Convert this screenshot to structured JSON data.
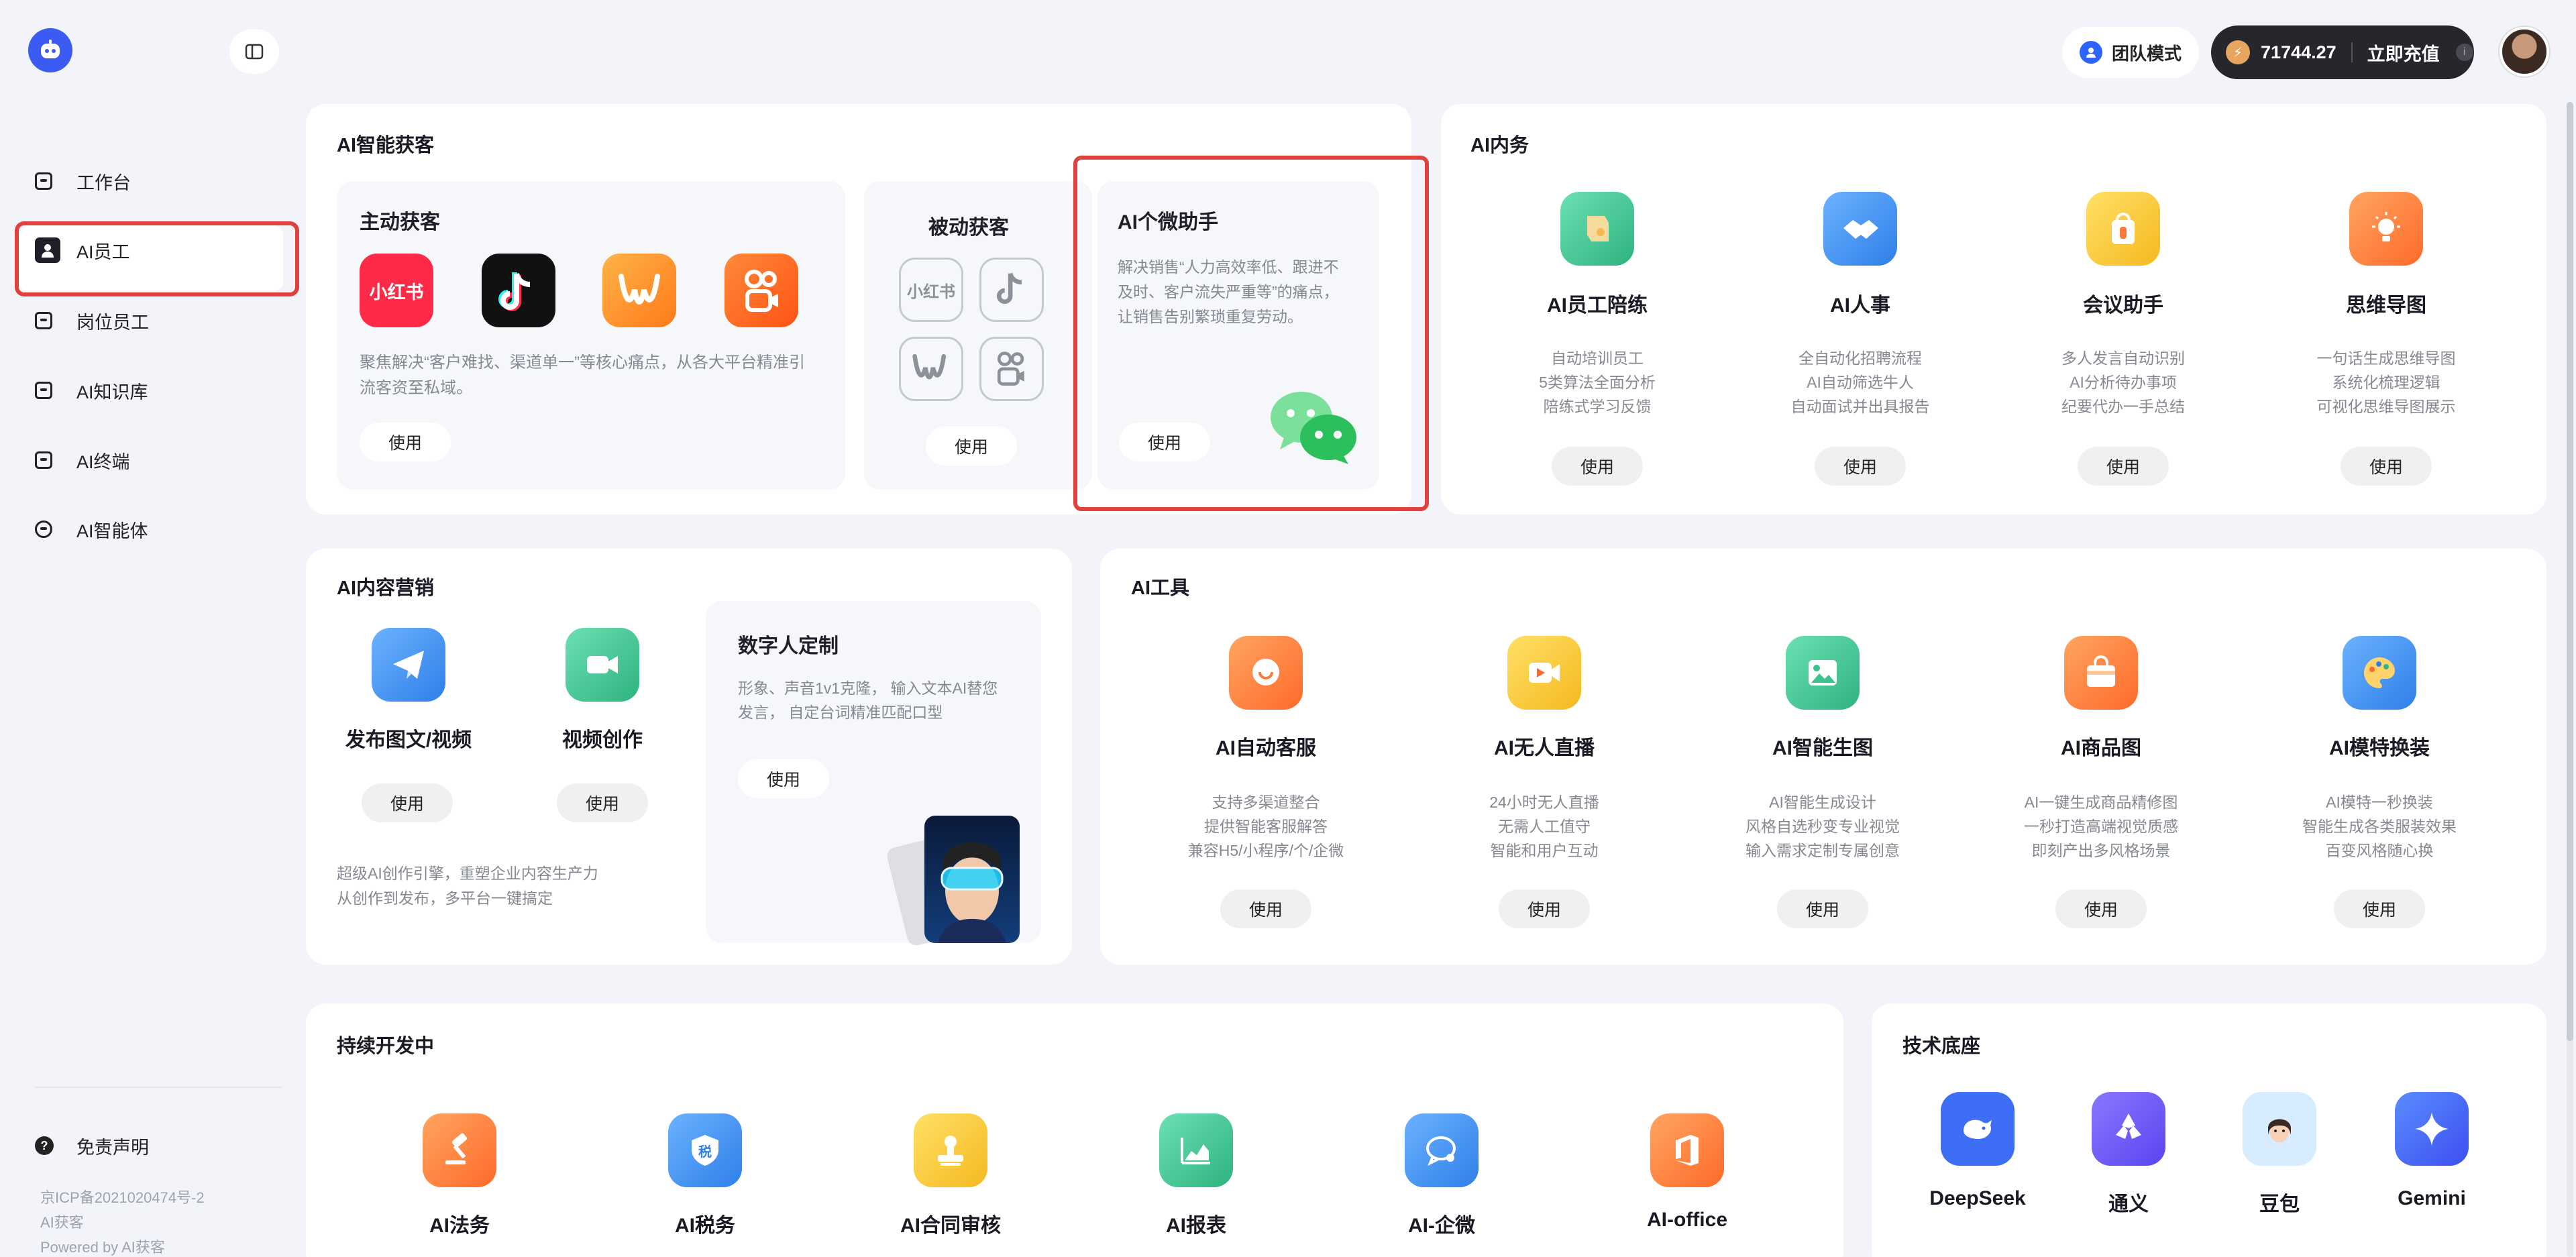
{
  "header": {
    "team_mode_label": "团队模式",
    "balance": "71744.27",
    "recharge_label": "立即充值",
    "info_glyph": "i"
  },
  "sidebar": {
    "items": [
      {
        "label": "工作台",
        "icon": "workbench-icon"
      },
      {
        "label": "AI员工",
        "icon": "ai-staff-icon"
      },
      {
        "label": "岗位员工",
        "icon": "post-staff-icon"
      },
      {
        "label": "AI知识库",
        "icon": "knowledge-icon"
      },
      {
        "label": "AI终端",
        "icon": "terminal-icon"
      },
      {
        "label": "AI智能体",
        "icon": "agent-icon"
      }
    ],
    "disclaimer": "免责声明",
    "icp": "京ICP备2021020474号-2",
    "brand": "AI获客",
    "powered": "Powered by AI获客"
  },
  "acquire": {
    "title": "AI智能获客",
    "active": {
      "title": "主动获客",
      "desc_lines": [
        "聚焦解决“客户难找、渠道单一”等核心痛点，从各大平台精准引",
        "流客资至私域。"
      ],
      "use": "使用",
      "platforms": [
        "小红书",
        "抖音",
        "快手",
        "快手"
      ]
    },
    "passive": {
      "title": "被动获客",
      "use": "使用",
      "xhs_label": "小红书"
    },
    "wechat": {
      "title": "AI个微助手",
      "desc_lines": [
        "解决销售“人力高效率低、跟进不",
        "及时、客户流失严重等”的痛点，",
        "让销售告别繁琐重复劳动。"
      ],
      "use": "使用"
    }
  },
  "internal": {
    "title": "AI内务",
    "items": [
      {
        "name": "AI员工陪练",
        "desc": [
          "自动培训员工",
          "5类算法全面分析",
          "陪练式学习反馈"
        ],
        "use": "使用"
      },
      {
        "name": "AI人事",
        "desc": [
          "全自动化招聘流程",
          "AI自动筛选牛人",
          "自动面试并出具报告"
        ],
        "use": "使用"
      },
      {
        "name": "会议助手",
        "desc": [
          "多人发言自动识别",
          "AI分析待办事项",
          "纪要代办一手总结"
        ],
        "use": "使用"
      },
      {
        "name": "思维导图",
        "desc": [
          "一句话生成思维导图",
          "系统化梳理逻辑",
          "可视化思维导图展示"
        ],
        "use": "使用"
      }
    ]
  },
  "content": {
    "title": "AI内容营销",
    "items": [
      {
        "name": "发布图文/视频",
        "use": "使用"
      },
      {
        "name": "视频创作",
        "use": "使用"
      }
    ],
    "footer_lines": [
      "超级AI创作引擎，重塑企业内容生产力",
      "从创作到发布，多平台一键搞定"
    ],
    "digital": {
      "title": "数字人定制",
      "desc_lines": [
        "形象、声音1v1克隆， 输入文本AI替您",
        "发言， 自定台词精准匹配口型"
      ],
      "use": "使用"
    }
  },
  "tools": {
    "title": "AI工具",
    "items": [
      {
        "name": "AI自动客服",
        "desc": [
          "支持多渠道整合",
          "提供智能客服解答",
          "兼容H5/小程序/个/企微"
        ],
        "use": "使用"
      },
      {
        "name": "AI无人直播",
        "desc": [
          "24小时无人直播",
          "无需人工值守",
          "智能和用户互动"
        ],
        "use": "使用"
      },
      {
        "name": "AI智能生图",
        "desc": [
          "AI智能生成设计",
          "风格自选秒变专业视觉",
          "输入需求定制专属创意"
        ],
        "use": "使用"
      },
      {
        "name": "AI商品图",
        "desc": [
          "AI一键生成商品精修图",
          "一秒打造高端视觉质感",
          "即刻产出多风格场景"
        ],
        "use": "使用"
      },
      {
        "name": "AI模特换装",
        "desc": [
          "AI模特一秒换装",
          "智能生成各类服装效果",
          "百变风格随心换"
        ],
        "use": "使用"
      }
    ]
  },
  "dev": {
    "title": "持续开发中",
    "items": [
      {
        "name": "AI法务"
      },
      {
        "name": "AI税务",
        "badge": "税"
      },
      {
        "name": "AI合同审核"
      },
      {
        "name": "AI报表"
      },
      {
        "name": "AI-企微"
      },
      {
        "name": "AI-office"
      }
    ]
  },
  "tech": {
    "title": "技术底座",
    "items": [
      {
        "name": "DeepSeek"
      },
      {
        "name": "通义"
      },
      {
        "name": "豆包"
      },
      {
        "name": "Gemini"
      }
    ]
  },
  "colors": {
    "accent_blue": "#2f63ff",
    "highlight_red": "#e0413c",
    "wechat_green": "#2bc05c"
  }
}
